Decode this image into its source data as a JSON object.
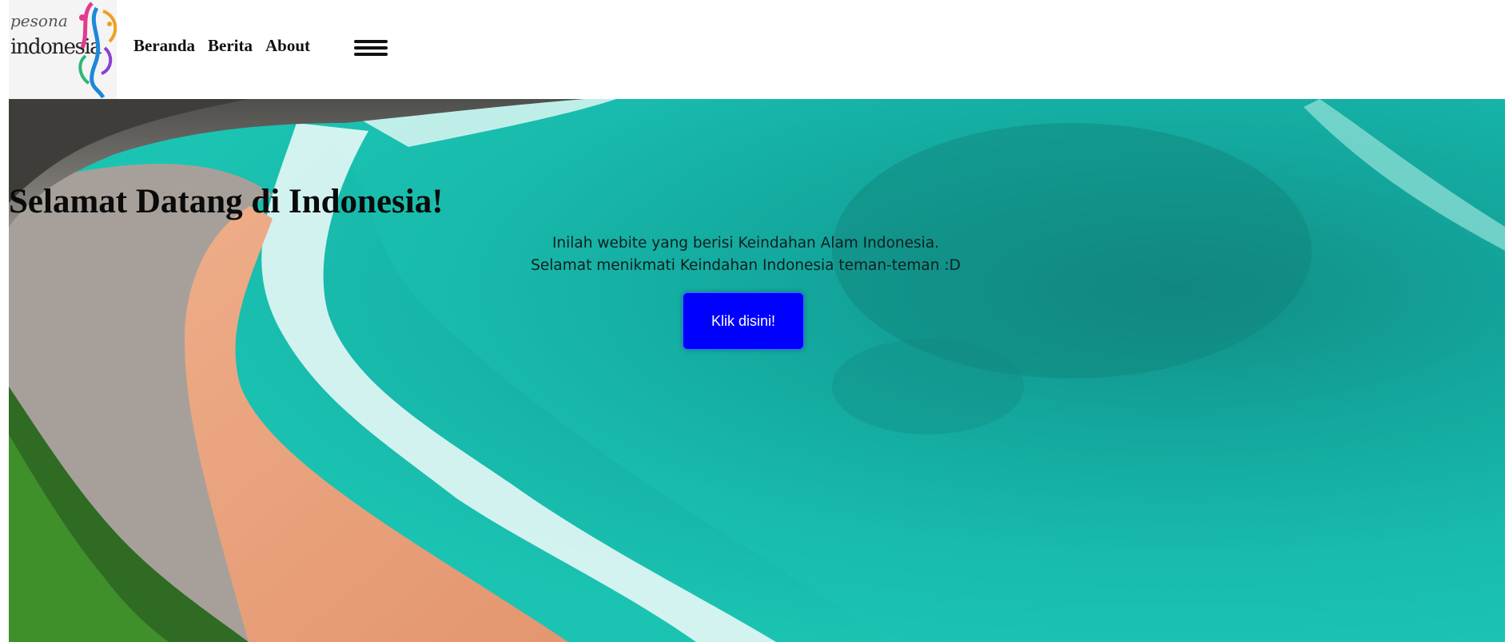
{
  "logo": {
    "line1": "pesona",
    "line2": "indonesia"
  },
  "nav": {
    "items": [
      "Beranda",
      "Berita",
      "About"
    ]
  },
  "hero": {
    "title": "Selamat Datang di Indonesia!",
    "subtitle_line1": "Inilah webite yang berisi Keindahan Alam Indonesia.",
    "subtitle_line2": "Selamat menikmati Keindahan Indonesia teman-teman :D",
    "button_label": "Klik disini!"
  },
  "colors": {
    "button_bg": "#0000ff",
    "sea": "#12b3a6",
    "sand": "#e9a07a"
  },
  "icons": {
    "menu": "hamburger-icon"
  }
}
